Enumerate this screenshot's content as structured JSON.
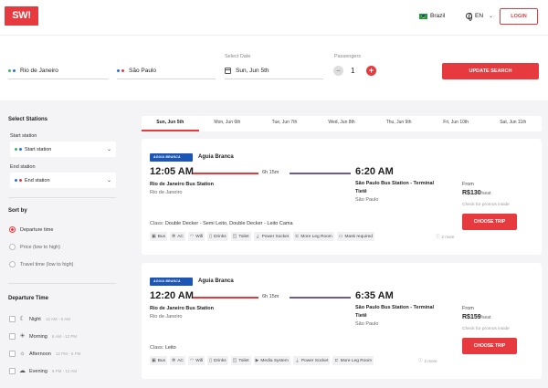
{
  "header": {
    "logo": "SW!",
    "country": "Brazil",
    "language": "EN",
    "login_label": "LOGIN"
  },
  "search": {
    "from": "Rio de Janeiro",
    "to": "São Paulo",
    "date_label": "Select Date",
    "date_value": "Sun, Jun 5th",
    "passengers_label": "Passengers",
    "passengers_value": "1",
    "minus_label": "−",
    "plus_label": "+",
    "update_label": "UPDATE SEARCH"
  },
  "sidebar": {
    "stations_title": "Select Stations",
    "start_label": "Start station",
    "start_value": "Start station",
    "end_label": "End station",
    "end_value": "End station",
    "sort_title": "Sort by",
    "sort_options": [
      "Departure time",
      "Price (low to high)",
      "Travel time (low to high)"
    ],
    "dep_time_title": "Departure Time",
    "time_slots": [
      {
        "label": "Night",
        "range": "12 AM - 6 AM"
      },
      {
        "label": "Morning",
        "range": "6 AM - 12 PM"
      },
      {
        "label": "Afternoon",
        "range": "12 PM - 6 PM"
      },
      {
        "label": "Evening",
        "range": "6 PM - 12 AM"
      }
    ]
  },
  "date_tabs": [
    "Sun, Jun 5th",
    "Mon, Jun 6th",
    "Tue, Jun 7th",
    "Wed, Jun 8th",
    "Thu, Jun 9th",
    "Fri, Jun 10th",
    "Sat, Jun 11th"
  ],
  "trips": [
    {
      "operator": "Aguia Branca",
      "dep_time": "12:05 AM",
      "arr_time": "6:20 AM",
      "duration": "6h 15m",
      "dep_station": "Rio de Janeiro Bus Station",
      "dep_city": "Rio de Janeiro",
      "arr_station_line1": "São Paulo Bus Station - Terminal",
      "arr_station_line2": "Tietê",
      "arr_city": "São Paulo",
      "class_label": "Class:",
      "class_value": "Double Decker - Semi Leito, Double Decker - Leito Cama",
      "amenities": [
        "Bus",
        "AC",
        "Wifi",
        "Drinks",
        "Toilet",
        "Power Socket",
        "More Leg Room",
        "Mask required"
      ],
      "more": "2 more",
      "from_label": "From",
      "price": "R$130",
      "per_seat": "/seat",
      "promo": "Check for promos inside",
      "choose_label": "CHOOSE TRIP"
    },
    {
      "operator": "Aguia Branca",
      "dep_time": "12:20 AM",
      "arr_time": "6:35 AM",
      "duration": "6h 15m",
      "dep_station": "Rio de Janeiro Bus Station",
      "dep_city": "Rio de Janeiro",
      "arr_station_line1": "São Paulo Bus Station - Terminal",
      "arr_station_line2": "Tietê",
      "arr_city": "São Paulo",
      "class_label": "Class:",
      "class_value": "Leito",
      "amenities": [
        "Bus",
        "AC",
        "Wifi",
        "Drinks",
        "Toilet",
        "Media System",
        "Power Socket",
        "More Leg Room"
      ],
      "more": "2 more",
      "from_label": "From",
      "price": "R$159",
      "per_seat": "/seat",
      "promo": "Check for promos inside",
      "choose_label": "CHOOSE TRIP"
    }
  ],
  "colors": {
    "accent": "#e63a3e",
    "operator_blue": "#1b55b5",
    "route_purple": "#6b5aa8",
    "origin_green": "#3cb371",
    "dest_blue": "#2f6fd6"
  }
}
